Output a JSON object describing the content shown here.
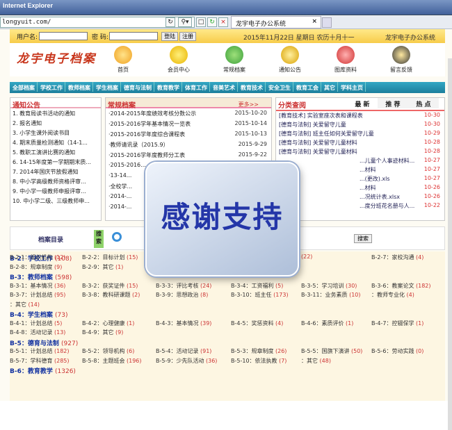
{
  "browser": {
    "title": "Internet Explorer",
    "address": "longyuit.com/",
    "tab_label": "龙宇电子办公系统"
  },
  "login": {
    "user_label": "用户名:",
    "pwd_label": "密 码:",
    "login_btn": "登陆",
    "register_btn": "注册",
    "date": "2015年11月22日 星期日 农历十月十一",
    "system": "龙宇电子办公系统"
  },
  "header": {
    "logo": "龙宇电子档案",
    "nav": [
      "首页",
      "会员中心",
      "常规档案",
      "通知公告",
      "图库资料",
      "留言反馈"
    ]
  },
  "menu": [
    "全部档案",
    "学校工作",
    "教师档案",
    "学生档案",
    "德育与法制",
    "教育教学",
    "体育工作",
    "音美艺术",
    "教育技术",
    "安全卫生",
    "教育工会",
    "其它",
    "学科主页"
  ],
  "notice": {
    "title": "通知公告",
    "items": [
      "1. 教育局读书活动的通知",
      "2. 报名通知",
      "3. 小学生课外阅读书目",
      "4. 期末质量检测通知（14-1...",
      "5. 教职工演讲比赛的通知",
      "6. 14-15年度第一学期期末质...",
      "7. 2014年国庆节放假通知",
      "8. 中小学高级教师资格评审...",
      "9. 中小学一级教师申报评审...",
      "10. 中小学二级、三级教师申..."
    ]
  },
  "regular": {
    "title": "常规档案",
    "more": "更多>>",
    "items": [
      {
        "t": "·2014-2015年度绩效考核分数公示",
        "d": "2015-10-20"
      },
      {
        "t": "·2015-2016学年基本情况一览表",
        "d": "2015-10-14"
      },
      {
        "t": "·2015-2016学年度综合课程表",
        "d": "2015-10-13"
      },
      {
        "t": "·教师请讯录（2015.9）",
        "d": "2015-9-29"
      },
      {
        "t": "·2015-2016学年度教师分工表",
        "d": "2015-9-22"
      },
      {
        "t": "·2015-2016...",
        "d": ""
      },
      {
        "t": "·13-14...",
        "d": ""
      },
      {
        "t": "·全校学...",
        "d": ""
      },
      {
        "t": "·2014-...",
        "d": ""
      },
      {
        "t": "·2014-...",
        "d": ""
      }
    ]
  },
  "category": {
    "title": "分类查阅",
    "tabs": [
      "最 新",
      "推 荐",
      "热 点"
    ],
    "items": [
      {
        "t": "[教育技术] 实验室座次表和课程表",
        "d": "10-30"
      },
      {
        "t": "[德育与法制] 关爱留守儿童",
        "d": "10-30"
      },
      {
        "t": "[德育与法制] 班主任如何关爱留守儿童",
        "d": "10-29"
      },
      {
        "t": "[德育与法制] 关爱留守儿童材料",
        "d": "10-28"
      },
      {
        "t": "[德育与法制] 关爱留守儿童材料",
        "d": "10-28"
      },
      {
        "t": "...儿童个人事迹材料...",
        "d": "10-27"
      },
      {
        "t": "...材料",
        "d": "10-27"
      },
      {
        "t": "...(更改).xls",
        "d": "10-27"
      },
      {
        "t": "...材料",
        "d": "10-26"
      },
      {
        "t": "...况统计表.xlsx",
        "d": "10-26"
      },
      {
        "t": "...度分班花名册与人...",
        "d": "10-22"
      }
    ]
  },
  "search": {
    "label": "档案目录",
    "side": "搜索",
    "button": "搜索"
  },
  "catalog": [
    {
      "h": "B-2：学校工作",
      "n": "(108)",
      "items": [
        [
          "B-2-1：组织机构",
          "(12)"
        ],
        [
          "B-2-2：目标计划",
          "(15)"
        ],
        [
          "",
          "(22)"
        ],
        [
          "B-2-7：家校沟通",
          "(4)"
        ]
      ]
    },
    {
      "items": [
        [
          "B-2-8：规章制度",
          "(9)"
        ],
        [
          "B-2-9：其它",
          "(1)"
        ]
      ]
    },
    {
      "h": "B-3：教师档案",
      "n": "(598)"
    },
    {
      "items": [
        [
          "B-3-1：基本情况",
          "(36)"
        ],
        [
          "B-3-2：获奖证件",
          "(15)"
        ],
        [
          "B-3-3：评比考核",
          "(24)"
        ],
        [
          "B-3-4：工资福利",
          "(5)"
        ],
        [
          "B-3-5：学习培训",
          "(30)"
        ],
        [
          "B-3-6：教案论文",
          "(182)"
        ]
      ]
    },
    {
      "items": [
        [
          "B-3-7：计划总结",
          "(95)"
        ],
        [
          "B-3-8：教科研课题",
          "(2)"
        ],
        [
          "B-3-9：思想政治",
          "(8)"
        ],
        [
          "B-3-10：班主任",
          "(173)"
        ],
        [
          "B-3-11：业务素质",
          "(10)"
        ],
        [
          "：教师专业化",
          "(4)"
        ]
      ]
    },
    {
      "items": [
        [
          "：其它",
          "(14)"
        ]
      ]
    },
    {
      "h": "B-4：学生档案",
      "n": "(73)"
    },
    {
      "items": [
        [
          "B-4-1：计划总结",
          "(5)"
        ],
        [
          "B-4-2：心理健康",
          "(1)"
        ],
        [
          "B-4-3：基本情况",
          "(39)"
        ],
        [
          "B-4-5：奖惩资料",
          "(4)"
        ],
        [
          "B-4-6：素质评价",
          "(1)"
        ],
        [
          "B-4-7：控辍保学",
          "(1)"
        ]
      ]
    },
    {
      "items": [
        [
          "B-4-8：活动记录",
          "(13)"
        ],
        [
          "B-4-9：其它",
          "(9)"
        ]
      ]
    },
    {
      "h": "B-5：德育与法制",
      "n": "(927)"
    },
    {
      "items": [
        [
          "B-5-1：计划总结",
          "(182)"
        ],
        [
          "B-5-2：领导机构",
          "(6)"
        ],
        [
          "B-5-4：活动记录",
          "(91)"
        ],
        [
          "B-5-3：规章制度",
          "(26)"
        ],
        [
          "B-5-5：国旗下演讲",
          "(50)"
        ],
        [
          "B-5-6：劳动实践",
          "(0)"
        ]
      ]
    },
    {
      "items": [
        [
          "B-5-7：学科德育",
          "(285)"
        ],
        [
          "B-5-8：主题班会",
          "(196)"
        ],
        [
          "B-5-9：少先队活动",
          "(36)"
        ],
        [
          "B-5-10：依法执教",
          "(7)"
        ],
        [
          "：其它",
          "(48)"
        ]
      ]
    },
    {
      "h": "B-6：教育教学",
      "n": "(1326)"
    }
  ],
  "overlay": {
    "text": "感谢支持"
  }
}
